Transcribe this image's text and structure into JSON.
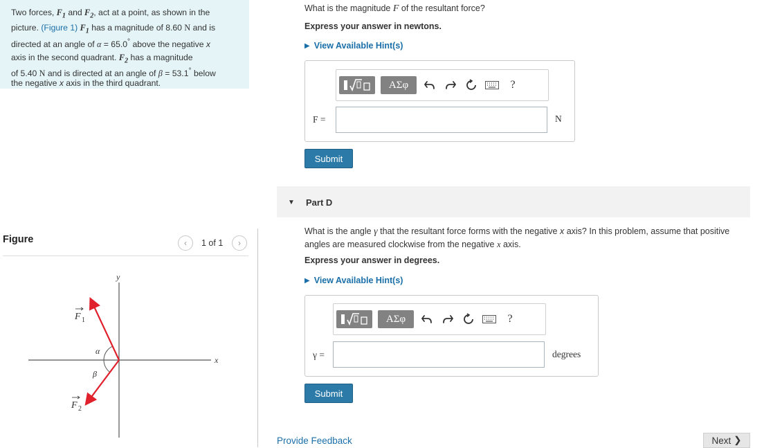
{
  "problem": {
    "line1_a": "Two forces,",
    "line1_f1": "F",
    "line1_sub1": "1",
    "line1_and": "and",
    "line1_f2": "F",
    "line1_sub2": "2",
    "line1_b": ", act at a point, as shown in the",
    "line2_a": "picture.",
    "figure_link": "(Figure 1)",
    "line2_f1": "F",
    "line2_sub1": "1",
    "line2_b": "has a magnitude of 8.60",
    "line2_unit": "N",
    "line2_c": "and is",
    "line3_a": "directed at an angle of",
    "line3_alpha": "α",
    "line3_b": "= 65.0",
    "line3_deg": "°",
    "line3_c": "above the negative",
    "line3_x": "x",
    "line4_a": "axis in the second quadrant.",
    "line4_f2": "F",
    "line4_sub2": "2",
    "line4_b": "has a magnitude",
    "line5_a": "of 5.40",
    "line5_unit": "N",
    "line5_b": "and is directed at an angle of",
    "line5_beta": "β",
    "line5_c": "= 53.1",
    "line5_deg": "°",
    "line5_d": "below",
    "line6_a": "the negative",
    "line6_x": "x",
    "line6_b": "axis in the third quadrant."
  },
  "figure": {
    "title": "Figure",
    "pager_prev": "‹",
    "pager_text": "1 of 1",
    "pager_next": "›",
    "y_label": "y",
    "x_label": "x",
    "f1_label": "F",
    "f1_sub": "1",
    "f2_label": "F",
    "f2_sub": "2",
    "alpha": "α",
    "beta": "β",
    "f1_angle_deg": 65.0,
    "f2_angle_deg": 53.1,
    "arrow_color": "#e0202b"
  },
  "partC": {
    "question_a": "What is the magnitude",
    "question_var": "F",
    "question_b": "of the resultant force?",
    "units_instruction": "Express your answer in newtons.",
    "hint_label": "View Available Hint(s)",
    "toolbar": {
      "template_icon": "fraction-root-template-icon",
      "greek_label": "ΑΣφ",
      "undo_icon": "undo-icon",
      "redo_icon": "redo-icon",
      "reset_icon": "reset-icon",
      "keyboard_icon": "keyboard-icon",
      "help_label": "?"
    },
    "input_label": "F =",
    "input_value": "",
    "unit": "N",
    "submit_label": "Submit"
  },
  "partD": {
    "title": "Part D",
    "question_a": "What is the angle",
    "question_var": "γ",
    "question_b": "that the resultant force forms with the negative",
    "question_x": "x",
    "question_c": "axis? In this problem, assume that positive",
    "question_line2_a": "angles are measured clockwise from the negative",
    "question_line2_x": "x",
    "question_line2_b": "axis.",
    "units_instruction": "Express your answer in degrees.",
    "hint_label": "View Available Hint(s)",
    "toolbar": {
      "greek_label": "ΑΣφ",
      "help_label": "?"
    },
    "input_label": "γ =",
    "input_value": "",
    "unit": "degrees",
    "submit_label": "Submit"
  },
  "footer": {
    "feedback_label": "Provide Feedback",
    "next_label": "Next"
  }
}
